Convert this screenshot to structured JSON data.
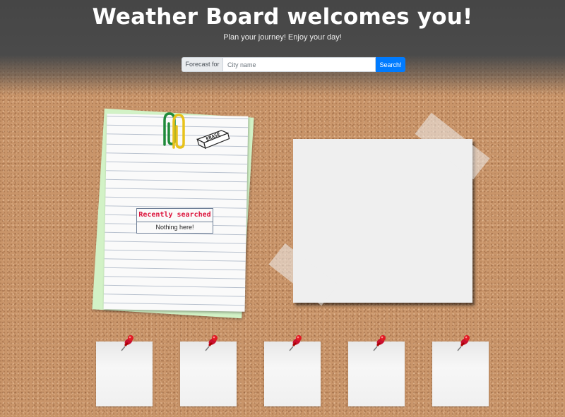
{
  "header": {
    "title": "Weather Board welcomes you!",
    "subtitle": "Plan your journey! Enjoy your day!"
  },
  "search": {
    "prefix_label": "Forecast for",
    "placeholder": "City name",
    "value": "",
    "button_label": "Search!"
  },
  "recent": {
    "title": "Recently searched",
    "empty_text": "Nothing here!"
  },
  "decorations": {
    "eraser_text": "ERASE"
  },
  "forecast_cards": [
    {
      "icon": "pushpin-icon"
    },
    {
      "icon": "pushpin-icon"
    },
    {
      "icon": "pushpin-icon"
    },
    {
      "icon": "pushpin-icon"
    },
    {
      "icon": "pushpin-icon"
    }
  ],
  "colors": {
    "accent": "#007bff",
    "recent_title": "#dc143c",
    "cork": "#c9956a",
    "pin": "#d01010"
  }
}
